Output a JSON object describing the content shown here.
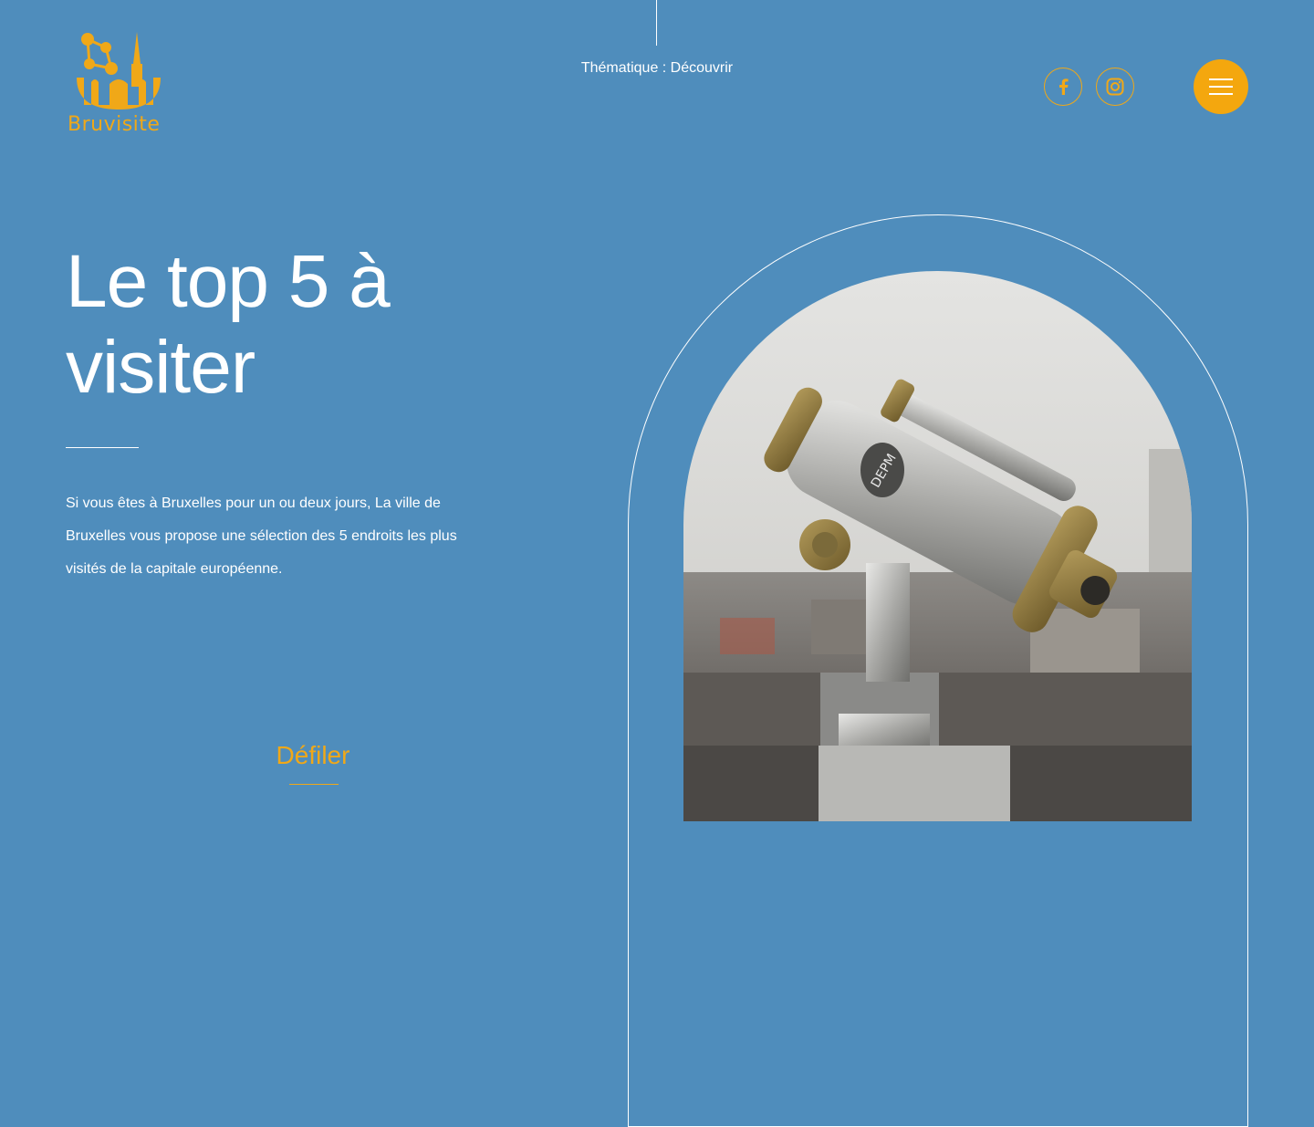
{
  "brand": {
    "name": "Bruvisite",
    "logo_icon": "atomium-cathedral-logo-icon",
    "accent_color": "#f4a70e",
    "background_color": "#4f8dbc"
  },
  "header": {
    "theme_label": "Thématique : Découvrir",
    "social": [
      {
        "name": "facebook",
        "icon": "facebook-icon"
      },
      {
        "name": "instagram",
        "icon": "instagram-icon"
      }
    ],
    "menu_icon": "hamburger-menu-icon"
  },
  "hero": {
    "title": "Le top 5 à visiter",
    "intro": "Si vous êtes à Bruxelles pour un ou deux jours, La ville de Bruxelles vous propose une sélection des 5 endroits les plus visités de la capitale européenne.",
    "scroll_label": "Défiler"
  },
  "image": {
    "subject": "coin-operated-telescope-photo",
    "plate_text": "DEPM"
  }
}
